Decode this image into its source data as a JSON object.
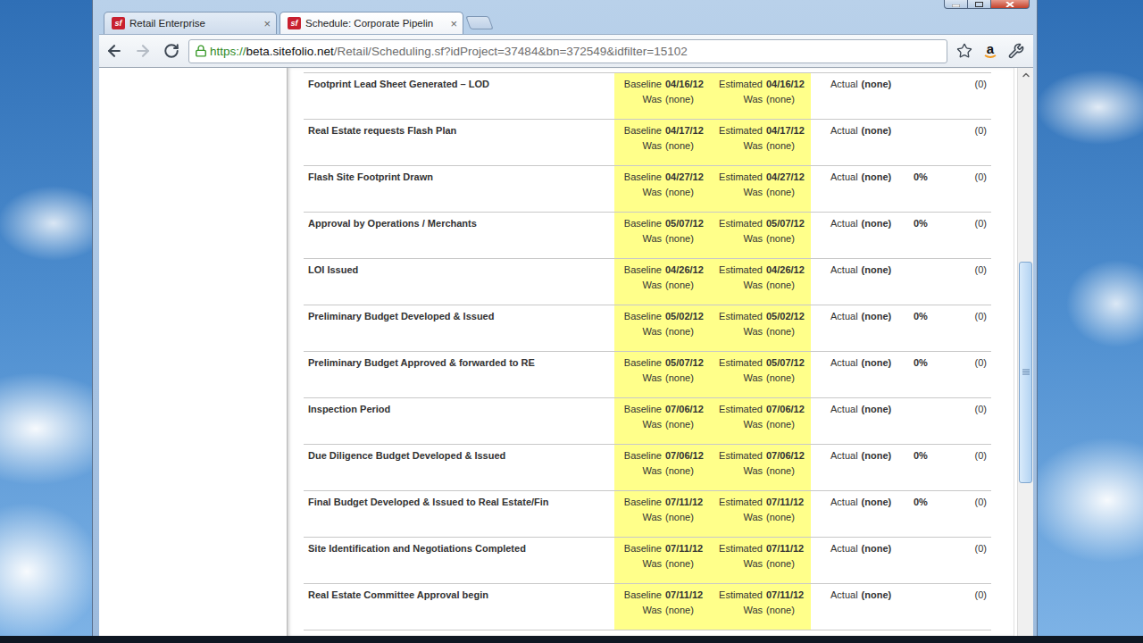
{
  "window": {
    "title": "Schedule: Corporate Pipelin"
  },
  "tabs": [
    {
      "label": "Retail Enterprise",
      "favicon": "sf",
      "close": "×",
      "selected": false
    },
    {
      "label": "Schedule: Corporate Pipelin",
      "favicon": "sf",
      "close": "×",
      "selected": true
    }
  ],
  "address_bar": {
    "scheme": "https://",
    "host": "beta.sitefolio.net",
    "path": "/Retail/Scheduling.sf?idProject=37484&bn=372549&idfilter=15102",
    "extension": "a"
  },
  "nav": {
    "back_enabled": true,
    "forward_enabled": false
  },
  "labels": {
    "baseline": "Baseline",
    "estimated": "Estimated",
    "was": "Was",
    "actual": "Actual"
  },
  "schedule": {
    "rows": [
      {
        "name": "Footprint Lead Sheet Generated – LOD",
        "baseline": "04/16/12",
        "estimated": "04/16/12",
        "baseline_was": "(none)",
        "estimated_was": "(none)",
        "actual": "(none)",
        "count": "(0)"
      },
      {
        "name": "Real Estate requests Flash Plan",
        "baseline": "04/17/12",
        "estimated": "04/17/12",
        "baseline_was": "(none)",
        "estimated_was": "(none)",
        "actual": "(none)",
        "count": "(0)"
      },
      {
        "name": "Flash Site Footprint Drawn",
        "baseline": "04/27/12",
        "estimated": "04/27/12",
        "baseline_was": "(none)",
        "estimated_was": "(none)",
        "actual": "(none)",
        "percent": "0%",
        "count": "(0)"
      },
      {
        "name": "Approval by Operations / Merchants",
        "baseline": "05/07/12",
        "estimated": "05/07/12",
        "baseline_was": "(none)",
        "estimated_was": "(none)",
        "actual": "(none)",
        "percent": "0%",
        "count": "(0)"
      },
      {
        "name": "LOI Issued",
        "baseline": "04/26/12",
        "estimated": "04/26/12",
        "baseline_was": "(none)",
        "estimated_was": "(none)",
        "actual": "(none)",
        "count": "(0)"
      },
      {
        "name": "Preliminary Budget Developed & Issued",
        "baseline": "05/02/12",
        "estimated": "05/02/12",
        "baseline_was": "(none)",
        "estimated_was": "(none)",
        "actual": "(none)",
        "percent": "0%",
        "count": "(0)"
      },
      {
        "name": "Preliminary Budget Approved & forwarded to RE",
        "baseline": "05/07/12",
        "estimated": "05/07/12",
        "baseline_was": "(none)",
        "estimated_was": "(none)",
        "actual": "(none)",
        "percent": "0%",
        "count": "(0)"
      },
      {
        "name": "Inspection Period",
        "baseline": "07/06/12",
        "estimated": "07/06/12",
        "baseline_was": "(none)",
        "estimated_was": "(none)",
        "actual": "(none)",
        "count": "(0)"
      },
      {
        "name": "Due Diligence Budget Developed & Issued",
        "baseline": "07/06/12",
        "estimated": "07/06/12",
        "baseline_was": "(none)",
        "estimated_was": "(none)",
        "actual": "(none)",
        "percent": "0%",
        "count": "(0)"
      },
      {
        "name": "Final Budget Developed & Issued to Real Estate/Fin",
        "baseline": "07/11/12",
        "estimated": "07/11/12",
        "baseline_was": "(none)",
        "estimated_was": "(none)",
        "actual": "(none)",
        "percent": "0%",
        "count": "(0)"
      },
      {
        "name": "Site Identification and Negotiations Completed",
        "baseline": "07/11/12",
        "estimated": "07/11/12",
        "baseline_was": "(none)",
        "estimated_was": "(none)",
        "actual": "(none)",
        "count": "(0)"
      },
      {
        "name": "Real Estate Committee Approval begin",
        "baseline": "07/11/12",
        "estimated": "07/11/12",
        "baseline_was": "(none)",
        "estimated_was": "(none)",
        "actual": "(none)",
        "count": "(0)"
      }
    ]
  },
  "scrollbar": {
    "thumb_start": 0.324,
    "thumb_size": 0.4
  }
}
